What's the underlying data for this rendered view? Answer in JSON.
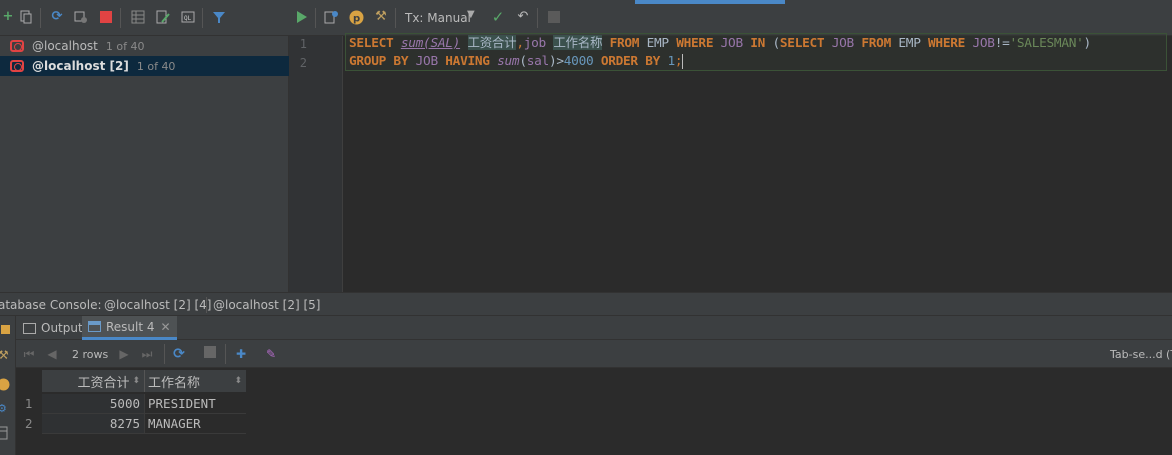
{
  "sessions": [
    {
      "name": "@localhost",
      "count": "1 of 40",
      "selected": false
    },
    {
      "name": "@localhost [2]",
      "count": "1 of 40",
      "selected": true
    }
  ],
  "editor_toolbar": {
    "tx_mode": "Tx: Manual"
  },
  "editor": {
    "line_numbers": [
      "1",
      "2"
    ]
  },
  "console_tabs": [
    "atabase Console:",
    "@localhost [2] [4]",
    "@localhost [2] [5]"
  ],
  "result_tabs": {
    "output": "Output",
    "result": "Result 4"
  },
  "result_toolbar": {
    "row_count": "2 rows",
    "view_mode": "Tab-se...d (T"
  },
  "grid": {
    "columns": [
      "工资合计",
      "工作名称"
    ],
    "rows": [
      {
        "num": "1",
        "cells": [
          "5000",
          "PRESIDENT"
        ]
      },
      {
        "num": "2",
        "cells": [
          "8275",
          "MANAGER"
        ]
      }
    ]
  },
  "colors": {
    "keyword": "#cc7832",
    "function": "#9876aa",
    "string": "#6a8759",
    "number": "#6897bb",
    "run": "#59a869",
    "stop": "#e04343",
    "accent": "#4a88c7"
  },
  "icons": [
    "add-icon",
    "duplicate-icon",
    "refresh-icon",
    "settings-icon",
    "stop-icon",
    "table-icon",
    "edit-icon",
    "console-icon",
    "filter-icon",
    "run-icon",
    "explain-icon",
    "parameters-icon",
    "tools-icon",
    "commit-icon",
    "rollback-icon",
    "cancel-icon"
  ]
}
